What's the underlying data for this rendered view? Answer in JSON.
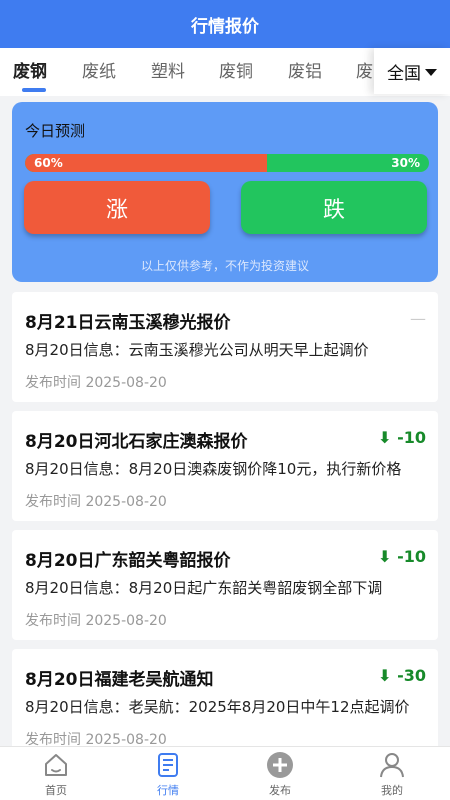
{
  "header": {
    "title": "行情报价"
  },
  "tabs": [
    "废钢",
    "废纸",
    "塑料",
    "废铜",
    "废铝",
    "废"
  ],
  "region": {
    "label": "全国"
  },
  "prediction": {
    "title": "今日预测",
    "up_percent": 60,
    "up_label": "60%",
    "down_label": "30%",
    "up_button": "涨",
    "down_button": "跌",
    "disclaimer": "以上仅供参考，不作为投资建议"
  },
  "news": [
    {
      "title": "8月21日云南玉溪穆光报价",
      "change": "—",
      "summary": "8月20日信息：云南玉溪穆光公司从明天早上起调价",
      "date": "发布时间 2025-08-20"
    },
    {
      "title": "8月20日河北石家庄澳森报价",
      "change": "⬇ -10",
      "summary": "8月20日信息：8月20日澳森废钢价降10元，执行新价格",
      "date": "发布时间 2025-08-20"
    },
    {
      "title": "8月20日广东韶关粤韶报价",
      "change": "⬇ -10",
      "summary": "8月20日信息：8月20日起广东韶关粤韶废钢全部下调",
      "date": "发布时间 2025-08-20"
    },
    {
      "title": "8月20日福建老吴航通知",
      "change": "⬇ -30",
      "summary": "8月20日信息：老吴航：2025年8月20日中午12点起调价",
      "date": "发布时间 2025-08-20"
    }
  ],
  "bottom_nav": [
    {
      "label": "首页",
      "icon": "home-icon"
    },
    {
      "label": "行情",
      "icon": "quotes-icon"
    },
    {
      "label": "发布",
      "icon": "plus-circle-icon"
    },
    {
      "label": "我的",
      "icon": "user-icon"
    }
  ],
  "colors": {
    "primary": "#3f7cf0",
    "up": "#f05a3a",
    "down": "#22c55e",
    "change_down": "#178a2a"
  }
}
